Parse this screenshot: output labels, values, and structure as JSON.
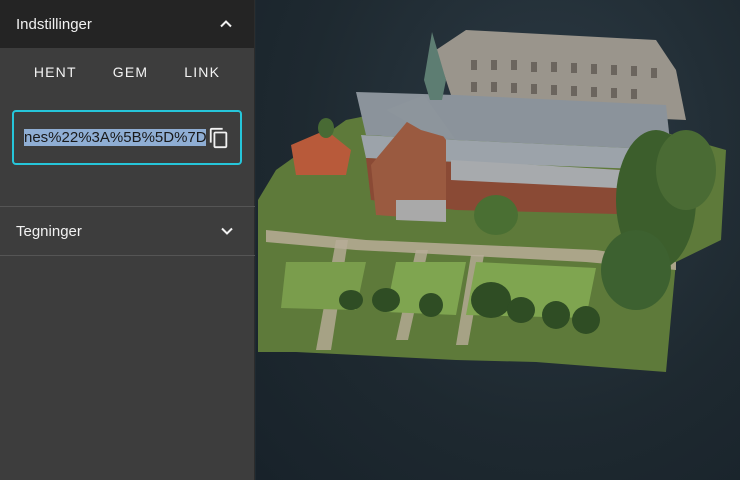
{
  "settings": {
    "title": "Indstillinger",
    "actions": [
      "HENT",
      "GEM",
      "LINK"
    ],
    "url_value": "nes%22%3A%5B%5D%7D"
  },
  "drawings": {
    "title": "Tegninger"
  },
  "colors": {
    "accent": "#26c6da",
    "panel": "#3d3d3d",
    "header": "#242424",
    "scene_bg": "#1f2a31"
  },
  "icons": [
    "chevron-up-icon",
    "copy-icon",
    "chevron-down-icon"
  ]
}
